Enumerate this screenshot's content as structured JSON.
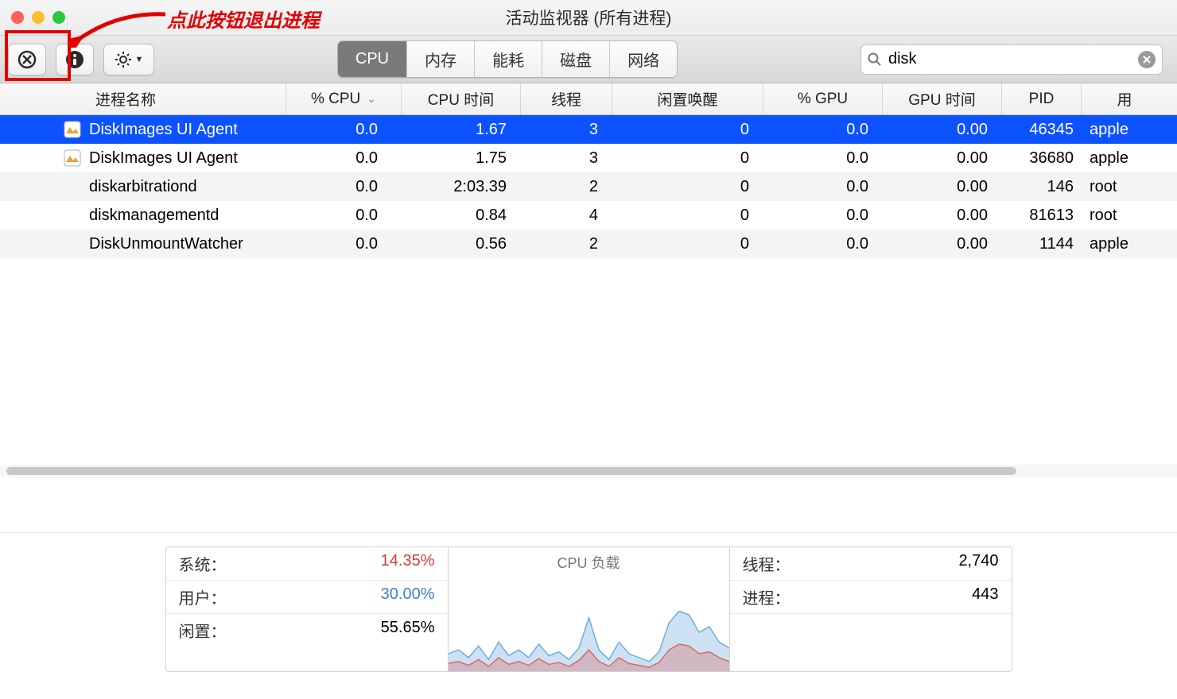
{
  "window": {
    "title": "活动监视器 (所有进程)"
  },
  "annotation": {
    "text": "点此按钮退出进程"
  },
  "tabs": {
    "items": [
      "CPU",
      "内存",
      "能耗",
      "磁盘",
      "网络"
    ],
    "active_index": 0
  },
  "search": {
    "value": "disk",
    "placeholder": ""
  },
  "icons": {
    "quit": "quit-process-icon",
    "info": "info-icon",
    "gear": "gear-icon",
    "chevron": "▼",
    "magnifier": "search-icon",
    "clear": "clear-icon",
    "sort_desc": "⌄"
  },
  "columns": {
    "name": "进程名称",
    "cpu": "% CPU",
    "time": "CPU 时间",
    "threads": "线程",
    "wakeups": "闲置唤醒",
    "gpu": "% GPU",
    "gtime": "GPU 时间",
    "pid": "PID",
    "user": "用"
  },
  "rows": [
    {
      "name": "DiskImages UI Agent",
      "cpu": "0.0",
      "time": "1.67",
      "threads": "3",
      "wakeups": "0",
      "gpu": "0.0",
      "gtime": "0.00",
      "pid": "46345",
      "user": "apple",
      "selected": true,
      "has_icon": true
    },
    {
      "name": "DiskImages UI Agent",
      "cpu": "0.0",
      "time": "1.75",
      "threads": "3",
      "wakeups": "0",
      "gpu": "0.0",
      "gtime": "0.00",
      "pid": "36680",
      "user": "apple",
      "selected": false,
      "has_icon": true
    },
    {
      "name": "diskarbitrationd",
      "cpu": "0.0",
      "time": "2:03.39",
      "threads": "2",
      "wakeups": "0",
      "gpu": "0.0",
      "gtime": "0.00",
      "pid": "146",
      "user": "root",
      "selected": false,
      "has_icon": false
    },
    {
      "name": "diskmanagementd",
      "cpu": "0.0",
      "time": "0.84",
      "threads": "4",
      "wakeups": "0",
      "gpu": "0.0",
      "gtime": "0.00",
      "pid": "81613",
      "user": "root",
      "selected": false,
      "has_icon": false
    },
    {
      "name": "DiskUnmountWatcher",
      "cpu": "0.0",
      "time": "0.56",
      "threads": "2",
      "wakeups": "0",
      "gpu": "0.0",
      "gtime": "0.00",
      "pid": "1144",
      "user": "apple",
      "selected": false,
      "has_icon": false
    }
  ],
  "footer": {
    "stats": {
      "system_label": "系统：",
      "system_value": "14.35%",
      "user_label": "用户：",
      "user_value": "30.00%",
      "idle_label": "闲置：",
      "idle_value": "55.65%"
    },
    "chart_title": "CPU 负载",
    "counts": {
      "threads_label": "线程：",
      "threads_value": "2,740",
      "procs_label": "进程：",
      "procs_value": "443"
    }
  },
  "chart_data": {
    "type": "area",
    "title": "CPU 负载",
    "xlabel": "",
    "ylabel": "",
    "ylim": [
      0,
      100
    ],
    "series": [
      {
        "name": "用户",
        "color": "#6eadde",
        "values": [
          18,
          22,
          14,
          26,
          12,
          30,
          16,
          22,
          14,
          28,
          16,
          20,
          12,
          24,
          55,
          22,
          12,
          30,
          18,
          14,
          10,
          20,
          50,
          62,
          58,
          40,
          46,
          30,
          24
        ]
      },
      {
        "name": "系统",
        "color": "#d86a6a",
        "values": [
          8,
          10,
          6,
          12,
          5,
          14,
          7,
          10,
          6,
          13,
          7,
          9,
          5,
          11,
          22,
          10,
          5,
          14,
          8,
          6,
          4,
          9,
          22,
          28,
          26,
          18,
          20,
          14,
          10
        ]
      }
    ]
  }
}
